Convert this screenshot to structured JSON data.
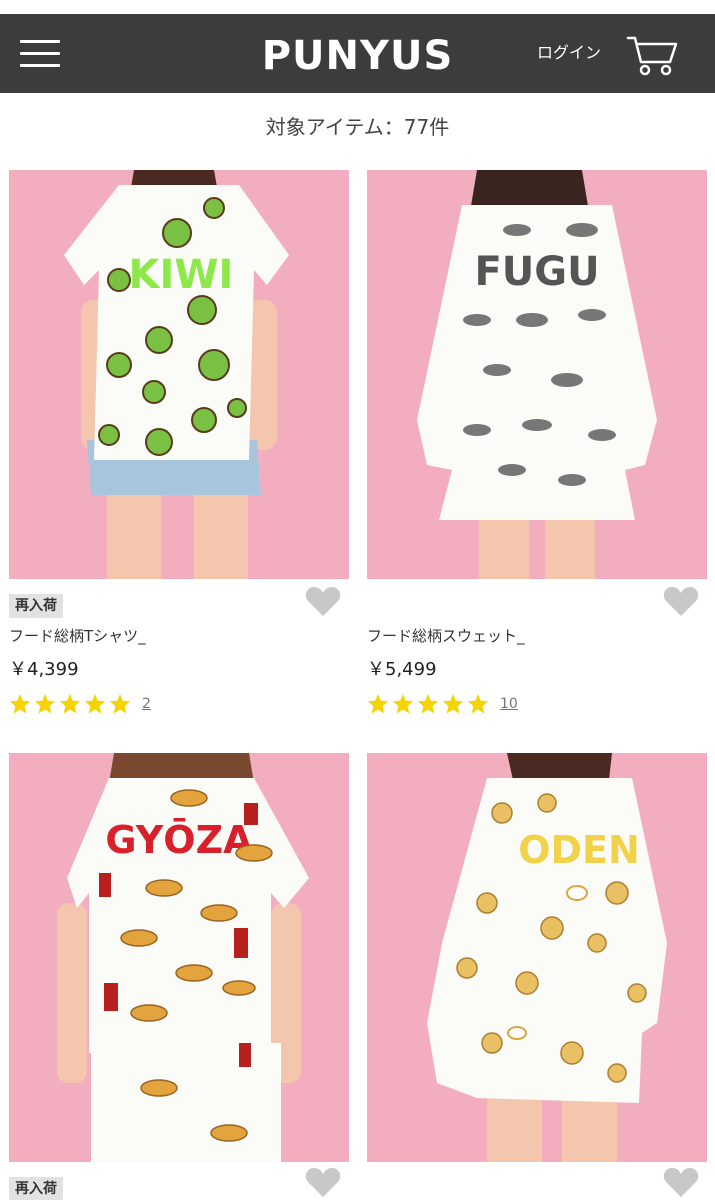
{
  "header": {
    "logo": "PUNYUS",
    "login_label": "ログイン"
  },
  "results": {
    "count_label": "対象アイテム：77件"
  },
  "products": [
    {
      "badge": "再入荷",
      "name": "フード総柄Tシャツ_",
      "price": "￥4,399",
      "rating": 5,
      "review_count": "2",
      "shirt_text": "KIWI",
      "shirt_text_color": "#8ee84a",
      "print_color": "#7ac143"
    },
    {
      "badge": "",
      "name": "フード総柄スウェット_",
      "price": "￥5,499",
      "rating": 5,
      "review_count": "10",
      "shirt_text": "FUGU",
      "shirt_text_color": "#555555",
      "print_color": "#777777"
    },
    {
      "badge": "再入荷",
      "shirt_text": "GYŌZA",
      "shirt_text_color": "#d8202a",
      "print_color": "#e3a33d"
    },
    {
      "badge": "",
      "shirt_text": "ODEN",
      "shirt_text_color": "#f1d24a",
      "print_color": "#e9c063"
    }
  ],
  "colors": {
    "header_bg": "#3c3c3c",
    "photo_bg": "#f2aebf",
    "star": "#f5d400",
    "heart": "#c8c8c8",
    "badge_bg": "#e2e2e2"
  }
}
